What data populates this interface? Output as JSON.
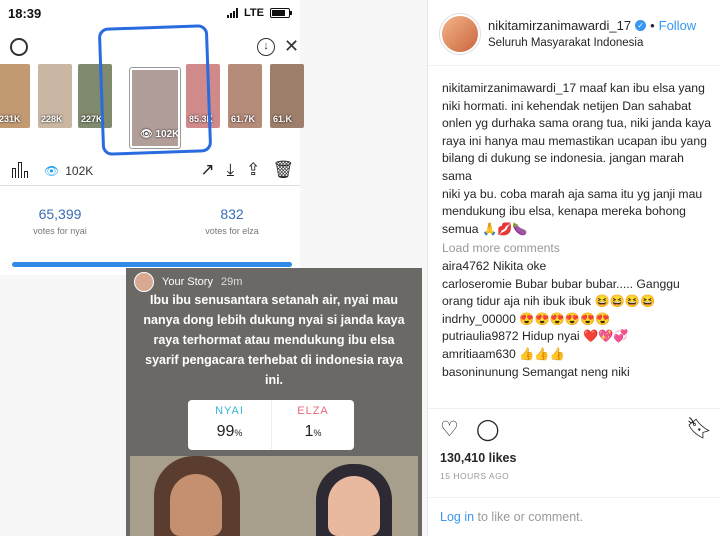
{
  "phone": {
    "time": "18:39",
    "network": "LTE",
    "thumbnails": [
      "231K",
      "228K",
      "227K",
      "102K",
      "85.3K",
      "61.7K",
      "61.K"
    ],
    "views": "102K",
    "votes": [
      {
        "count": "65,399",
        "label": "votes for nyai"
      },
      {
        "count": "832",
        "label": "votes for elza"
      }
    ]
  },
  "story": {
    "title": "Your Story",
    "time": "29m",
    "text": "Ibu ibu senusantara setanah air, nyai mau nanya dong lebih dukung nyai si janda kaya raya terhormat atau mendukung ibu elsa syarif pengacara terhebat di indonesia raya ini.",
    "poll": [
      {
        "option": "NYAI",
        "value": "99",
        "unit": "%",
        "color": "#3bb3d9"
      },
      {
        "option": "ELZA",
        "value": "1",
        "unit": "%",
        "color": "#e86a7a"
      }
    ]
  },
  "post": {
    "username": "nikitamirzanimawardi_17",
    "follow_label": "Follow",
    "location": "Seluruh Masyarakat Indonesia",
    "caption": "maaf kan ibu elsa yang niki hormati. ini kehendak netijen Dan sahabat onlen yg durhaka sama orang tua, niki janda kaya raya ini hanya mau memastikan ucapan ibu yang bilang di dukung se indonesia. jangan marah sama\nniki ya bu. coba marah aja sama itu yg janji mau mendukung ibu elsa, kenapa mereka bohong semua 🙏💋🍆",
    "load_more": "Load more comments",
    "comments": [
      {
        "user": "aira4762",
        "text": "Nikita oke"
      },
      {
        "user": "carloseromie",
        "text": "Bubar bubar bubar..... Ganggu orang tidur aja nih ibuk ibuk 😆😆😆😆"
      },
      {
        "user": "indrhy_00000",
        "text": "😍😍😍😍😍😍"
      },
      {
        "user": "putriaulia9872",
        "text": "Hidup nyai ❤️💖💞"
      },
      {
        "user": "amritiaam630",
        "text": "👍👍👍"
      },
      {
        "user": "basoninunung",
        "text": "Semangat neng niki"
      }
    ],
    "likes": "130,410 likes",
    "ago": "15 HOURS AGO",
    "login_link": "Log in",
    "login_rest": " to like or comment."
  }
}
